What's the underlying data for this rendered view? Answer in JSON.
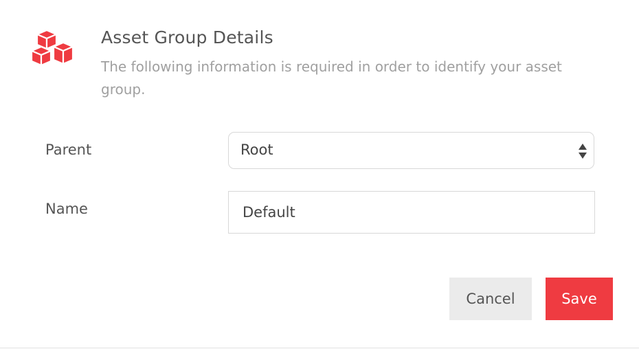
{
  "header": {
    "icon": "cubes-icon",
    "title": "Asset Group Details",
    "subtitle": "The following information is required in order to identify your asset group."
  },
  "form": {
    "parent": {
      "label": "Parent",
      "selected_value": "Root"
    },
    "name": {
      "label": "Name",
      "value": "Default"
    }
  },
  "actions": {
    "cancel_label": "Cancel",
    "save_label": "Save"
  },
  "colors": {
    "accent": "#ef3b41",
    "cancel_bg": "#ebebeb",
    "title_text": "#555555",
    "subtitle_text": "#a0a0a0"
  }
}
